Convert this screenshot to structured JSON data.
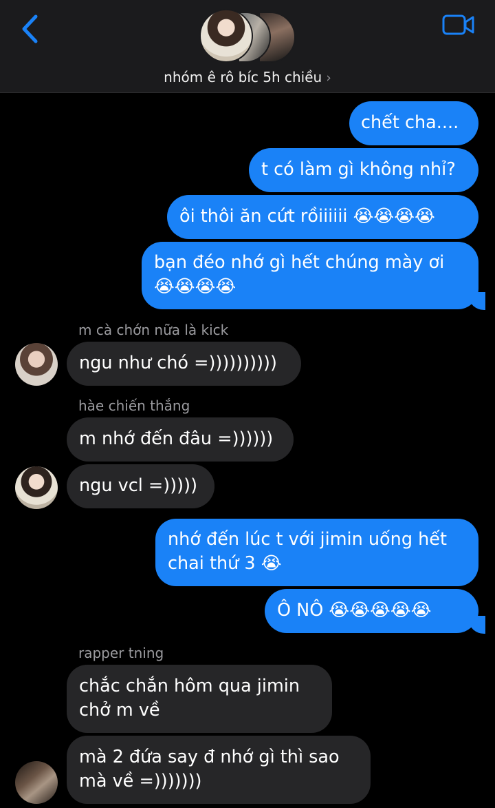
{
  "header": {
    "back_icon": "chevron-left-icon",
    "video_icon": "video-camera-icon",
    "group_name": "nhóm ê rô bíc 5h chiều",
    "group_chevron": "›",
    "accent_color": "#1a82f7"
  },
  "messages": {
    "m1": "chết cha....",
    "m2": "t có làm gì không nhỉ?",
    "m3": "ôi thôi ăn cứt rồiiiiii 😭😭😭😭",
    "m4_line1": "bạn đéo nhớ gì hết chúng mày ơi",
    "m4_line2": "😭😭😭😭",
    "sender1": "m cà chớn nữa là kick",
    "m5": "ngu như chó =))))))))))",
    "sender2": "hàe chiến thắng",
    "m6": "m nhớ đến đâu =))))))",
    "m7": "ngu vcl =)))))",
    "m8_line1": "nhớ đến lúc t với jimin uống hết",
    "m8_line2": "chai thứ 3 😭",
    "m9": "Ô NÔ 😭😭😭😭😭",
    "sender3": "rapper tning",
    "m10_line1": "chắc chắn hôm qua jimin",
    "m10_line2": "chở m về",
    "m11_line1": "mà 2 đứa say đ nhớ gì thì sao",
    "m11_line2": "mà về =)))))))"
  },
  "colors": {
    "outgoing_bubble": "#1a82f7",
    "incoming_bubble": "#262628",
    "background": "#000000"
  }
}
